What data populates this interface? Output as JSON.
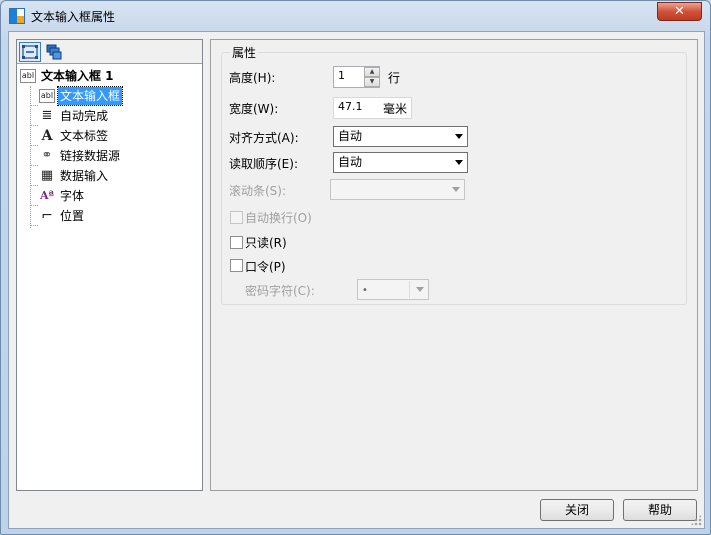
{
  "window": {
    "title": "文本输入框属性",
    "close_label": "✕"
  },
  "toolbar": {
    "buttons": [
      {
        "icon": "object-tree-icon",
        "active": true
      },
      {
        "icon": "layers-icon",
        "active": false
      }
    ]
  },
  "tree": {
    "root": {
      "label": "文本输入框 1",
      "icon_text": "abl"
    },
    "children": [
      {
        "label": "文本输入框",
        "icon_text": "abl",
        "selected": true
      },
      {
        "label": "自动完成",
        "icon_text": "≣"
      },
      {
        "label": "文本标签",
        "icon_text": "A"
      },
      {
        "label": "链接数据源",
        "icon_text": "⚭"
      },
      {
        "label": "数据输入",
        "icon_text": "▦"
      },
      {
        "label": "字体",
        "icon_text": "Aª"
      },
      {
        "label": "位置",
        "icon_text": "⌐"
      }
    ]
  },
  "properties": {
    "group_title": "属性",
    "height_label": "高度(H):",
    "height_value": "1",
    "height_unit": "行",
    "width_label": "宽度(W):",
    "width_value": "47.1",
    "width_unit": "毫米",
    "align_label": "对齐方式(A):",
    "align_value": "自动",
    "read_order_label": "读取顺序(E):",
    "read_order_value": "自动",
    "scrollbar_label": "滚动条(S):",
    "scrollbar_value": "",
    "autowrap_label": "自动换行(O)",
    "readonly_label": "只读(R)",
    "password_label": "口令(P)",
    "password_char_label": "密码字符(C):",
    "password_char_value": "•"
  },
  "footer": {
    "close_label": "关闭",
    "help_label": "帮助"
  },
  "colors": {
    "selection": "#3399ff",
    "close_button": "#c94a32"
  }
}
